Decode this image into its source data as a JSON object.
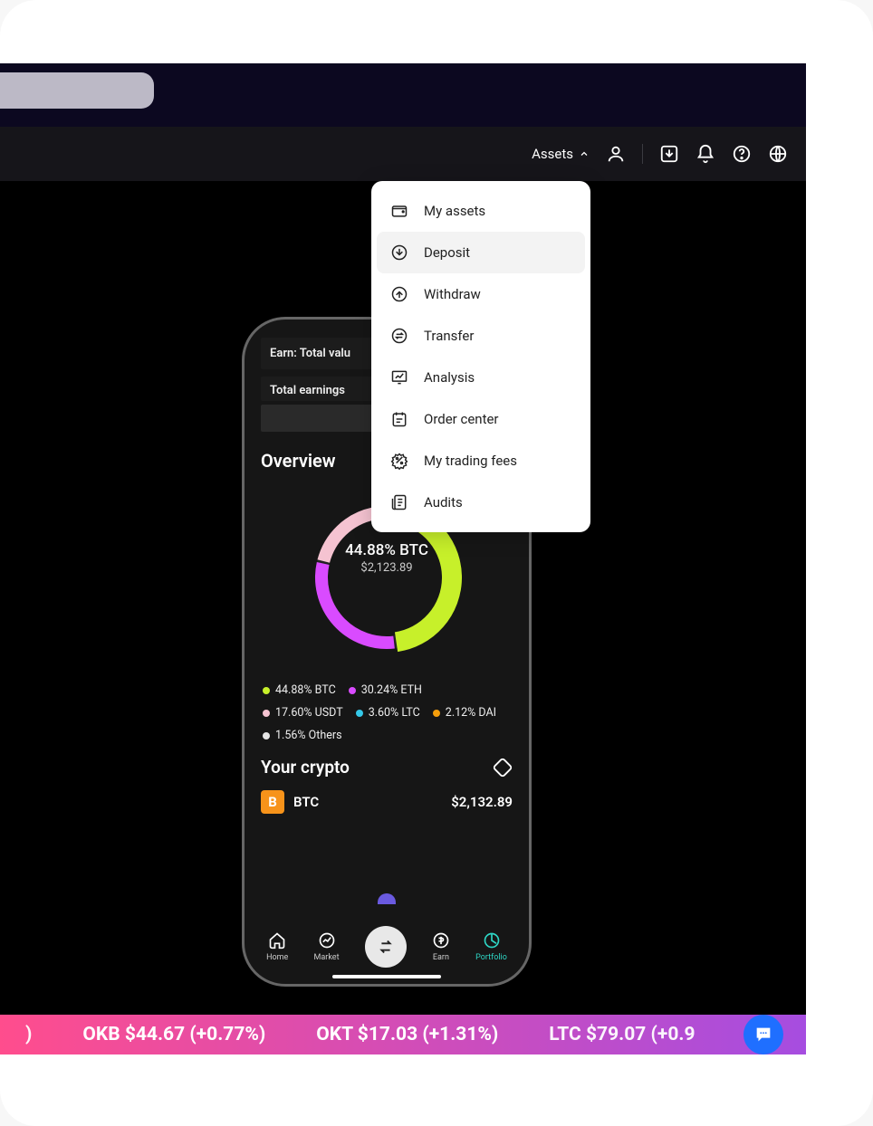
{
  "toolbar": {
    "assets_label": "Assets"
  },
  "dropdown": {
    "items": [
      {
        "label": "My assets",
        "icon": "wallet"
      },
      {
        "label": "Deposit",
        "icon": "deposit",
        "hover": true
      },
      {
        "label": "Withdraw",
        "icon": "withdraw"
      },
      {
        "label": "Transfer",
        "icon": "transfer"
      },
      {
        "label": "Analysis",
        "icon": "analysis"
      },
      {
        "label": "Order center",
        "icon": "order"
      },
      {
        "label": "My trading fees",
        "icon": "fees"
      },
      {
        "label": "Audits",
        "icon": "audits"
      }
    ]
  },
  "phone": {
    "earn_label": "Earn: Total valu",
    "total_earnings_label": "Total earnings",
    "overview_title": "Overview",
    "donut_center_line1": "44.88% BTC",
    "donut_center_line2": "$2,123.89",
    "legend": [
      {
        "label": "44.88% BTC",
        "color": "#c7f02a"
      },
      {
        "label": "30.24% ETH",
        "color": "#d94bff"
      },
      {
        "label": "17.60% USDT",
        "color": "#f5c3d1"
      },
      {
        "label": "3.60% LTC",
        "color": "#34c8e8"
      },
      {
        "label": "2.12% DAI",
        "color": "#f59e0b"
      },
      {
        "label": "1.56% Others",
        "color": "#e5e5e5"
      }
    ],
    "your_crypto_title": "Your crypto",
    "crypto": {
      "symbol": "BTC",
      "value": "$2,132.89",
      "badge": "B"
    },
    "tabs": [
      "Home",
      "Market",
      "",
      "Earn",
      "Portfolio"
    ]
  },
  "ticker": {
    "items": [
      {
        "text": ")",
        "partial": true
      },
      {
        "text": "OKB $44.67 (+0.77%)"
      },
      {
        "text": "OKT $17.03 (+1.31%)"
      },
      {
        "text": "LTC $79.07 (+0.9",
        "partial": true
      }
    ]
  },
  "chart_data": {
    "type": "pie",
    "title": "Overview",
    "center_label": "44.88% BTC",
    "center_value": "$2,123.89",
    "series": [
      {
        "name": "BTC",
        "value": 44.88,
        "color": "#c7f02a"
      },
      {
        "name": "ETH",
        "value": 30.24,
        "color": "#d94bff"
      },
      {
        "name": "USDT",
        "value": 17.6,
        "color": "#f5c3d1"
      },
      {
        "name": "LTC",
        "value": 3.6,
        "color": "#34c8e8"
      },
      {
        "name": "DAI",
        "value": 2.12,
        "color": "#f59e0b"
      },
      {
        "name": "Others",
        "value": 1.56,
        "color": "#e5e5e5"
      }
    ]
  }
}
